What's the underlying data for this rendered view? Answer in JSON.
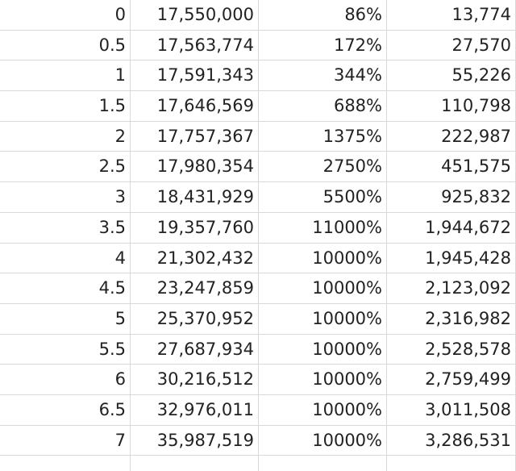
{
  "sheet": {
    "rows": [
      [
        "0",
        "17,550,000",
        "86%",
        "13,774"
      ],
      [
        "0.5",
        "17,563,774",
        "172%",
        "27,570"
      ],
      [
        "1",
        "17,591,343",
        "344%",
        "55,226"
      ],
      [
        "1.5",
        "17,646,569",
        "688%",
        "110,798"
      ],
      [
        "2",
        "17,757,367",
        "1375%",
        "222,987"
      ],
      [
        "2.5",
        "17,980,354",
        "2750%",
        "451,575"
      ],
      [
        "3",
        "18,431,929",
        "5500%",
        "925,832"
      ],
      [
        "3.5",
        "19,357,760",
        "11000%",
        "1,944,672"
      ],
      [
        "4",
        "21,302,432",
        "10000%",
        "1,945,428"
      ],
      [
        "4.5",
        "23,247,859",
        "10000%",
        "2,123,092"
      ],
      [
        "5",
        "25,370,952",
        "10000%",
        "2,316,982"
      ],
      [
        "5.5",
        "27,687,934",
        "10000%",
        "2,528,578"
      ],
      [
        "6",
        "30,216,512",
        "10000%",
        "2,759,499"
      ],
      [
        "6.5",
        "32,976,011",
        "10000%",
        "3,011,508"
      ],
      [
        "7",
        "35,987,519",
        "10000%",
        "3,286,531"
      ]
    ]
  },
  "colors": {
    "gridline": "#d9d9d9",
    "text": "#222222",
    "selection": "#217346"
  }
}
